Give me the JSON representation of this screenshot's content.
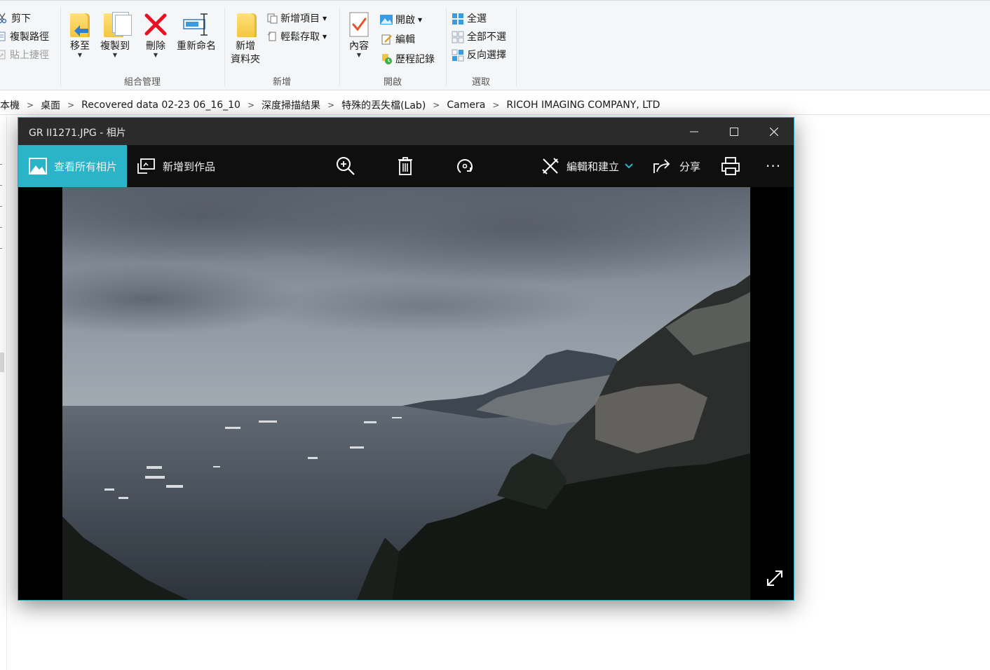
{
  "ribbon": {
    "clipboard": {
      "cut": "剪下",
      "copy_path": "複製路徑",
      "paste_shortcut": "貼上捷徑"
    },
    "organize": {
      "caption": "組合管理",
      "move_to": "移至",
      "copy_to": "複製到",
      "delete": "刪除",
      "rename": "重新命名"
    },
    "new": {
      "caption": "新增",
      "new_folder_line1": "新增",
      "new_folder_line2": "資料夾",
      "new_item": "新增項目",
      "easy_access": "輕鬆存取"
    },
    "open": {
      "caption": "開啟",
      "properties": "內容",
      "open": "開啟",
      "edit": "編輯",
      "history": "歷程記錄"
    },
    "select": {
      "caption": "選取",
      "select_all": "全選",
      "select_none": "全部不選",
      "invert": "反向選擇"
    }
  },
  "breadcrumb": [
    "本機",
    "桌面",
    "Recovered data 02-23 06_16_10",
    "深度掃描結果",
    "特殊的丟失檔(Lab)",
    "Camera",
    "RICOH IMAGING COMPANY, LTD"
  ],
  "photos": {
    "title": "GR II1271.JPG - 相片",
    "toolbar": {
      "view_all": "查看所有相片",
      "add_to_creation": "新增到作品",
      "edit_create": "編輯和建立",
      "share": "分享",
      "more": "···"
    }
  },
  "colors": {
    "accent": "#2bb3c7",
    "titlebar": "#2b2b2b",
    "toolbar": "#0f0f0f",
    "delete_red": "#e81123"
  }
}
